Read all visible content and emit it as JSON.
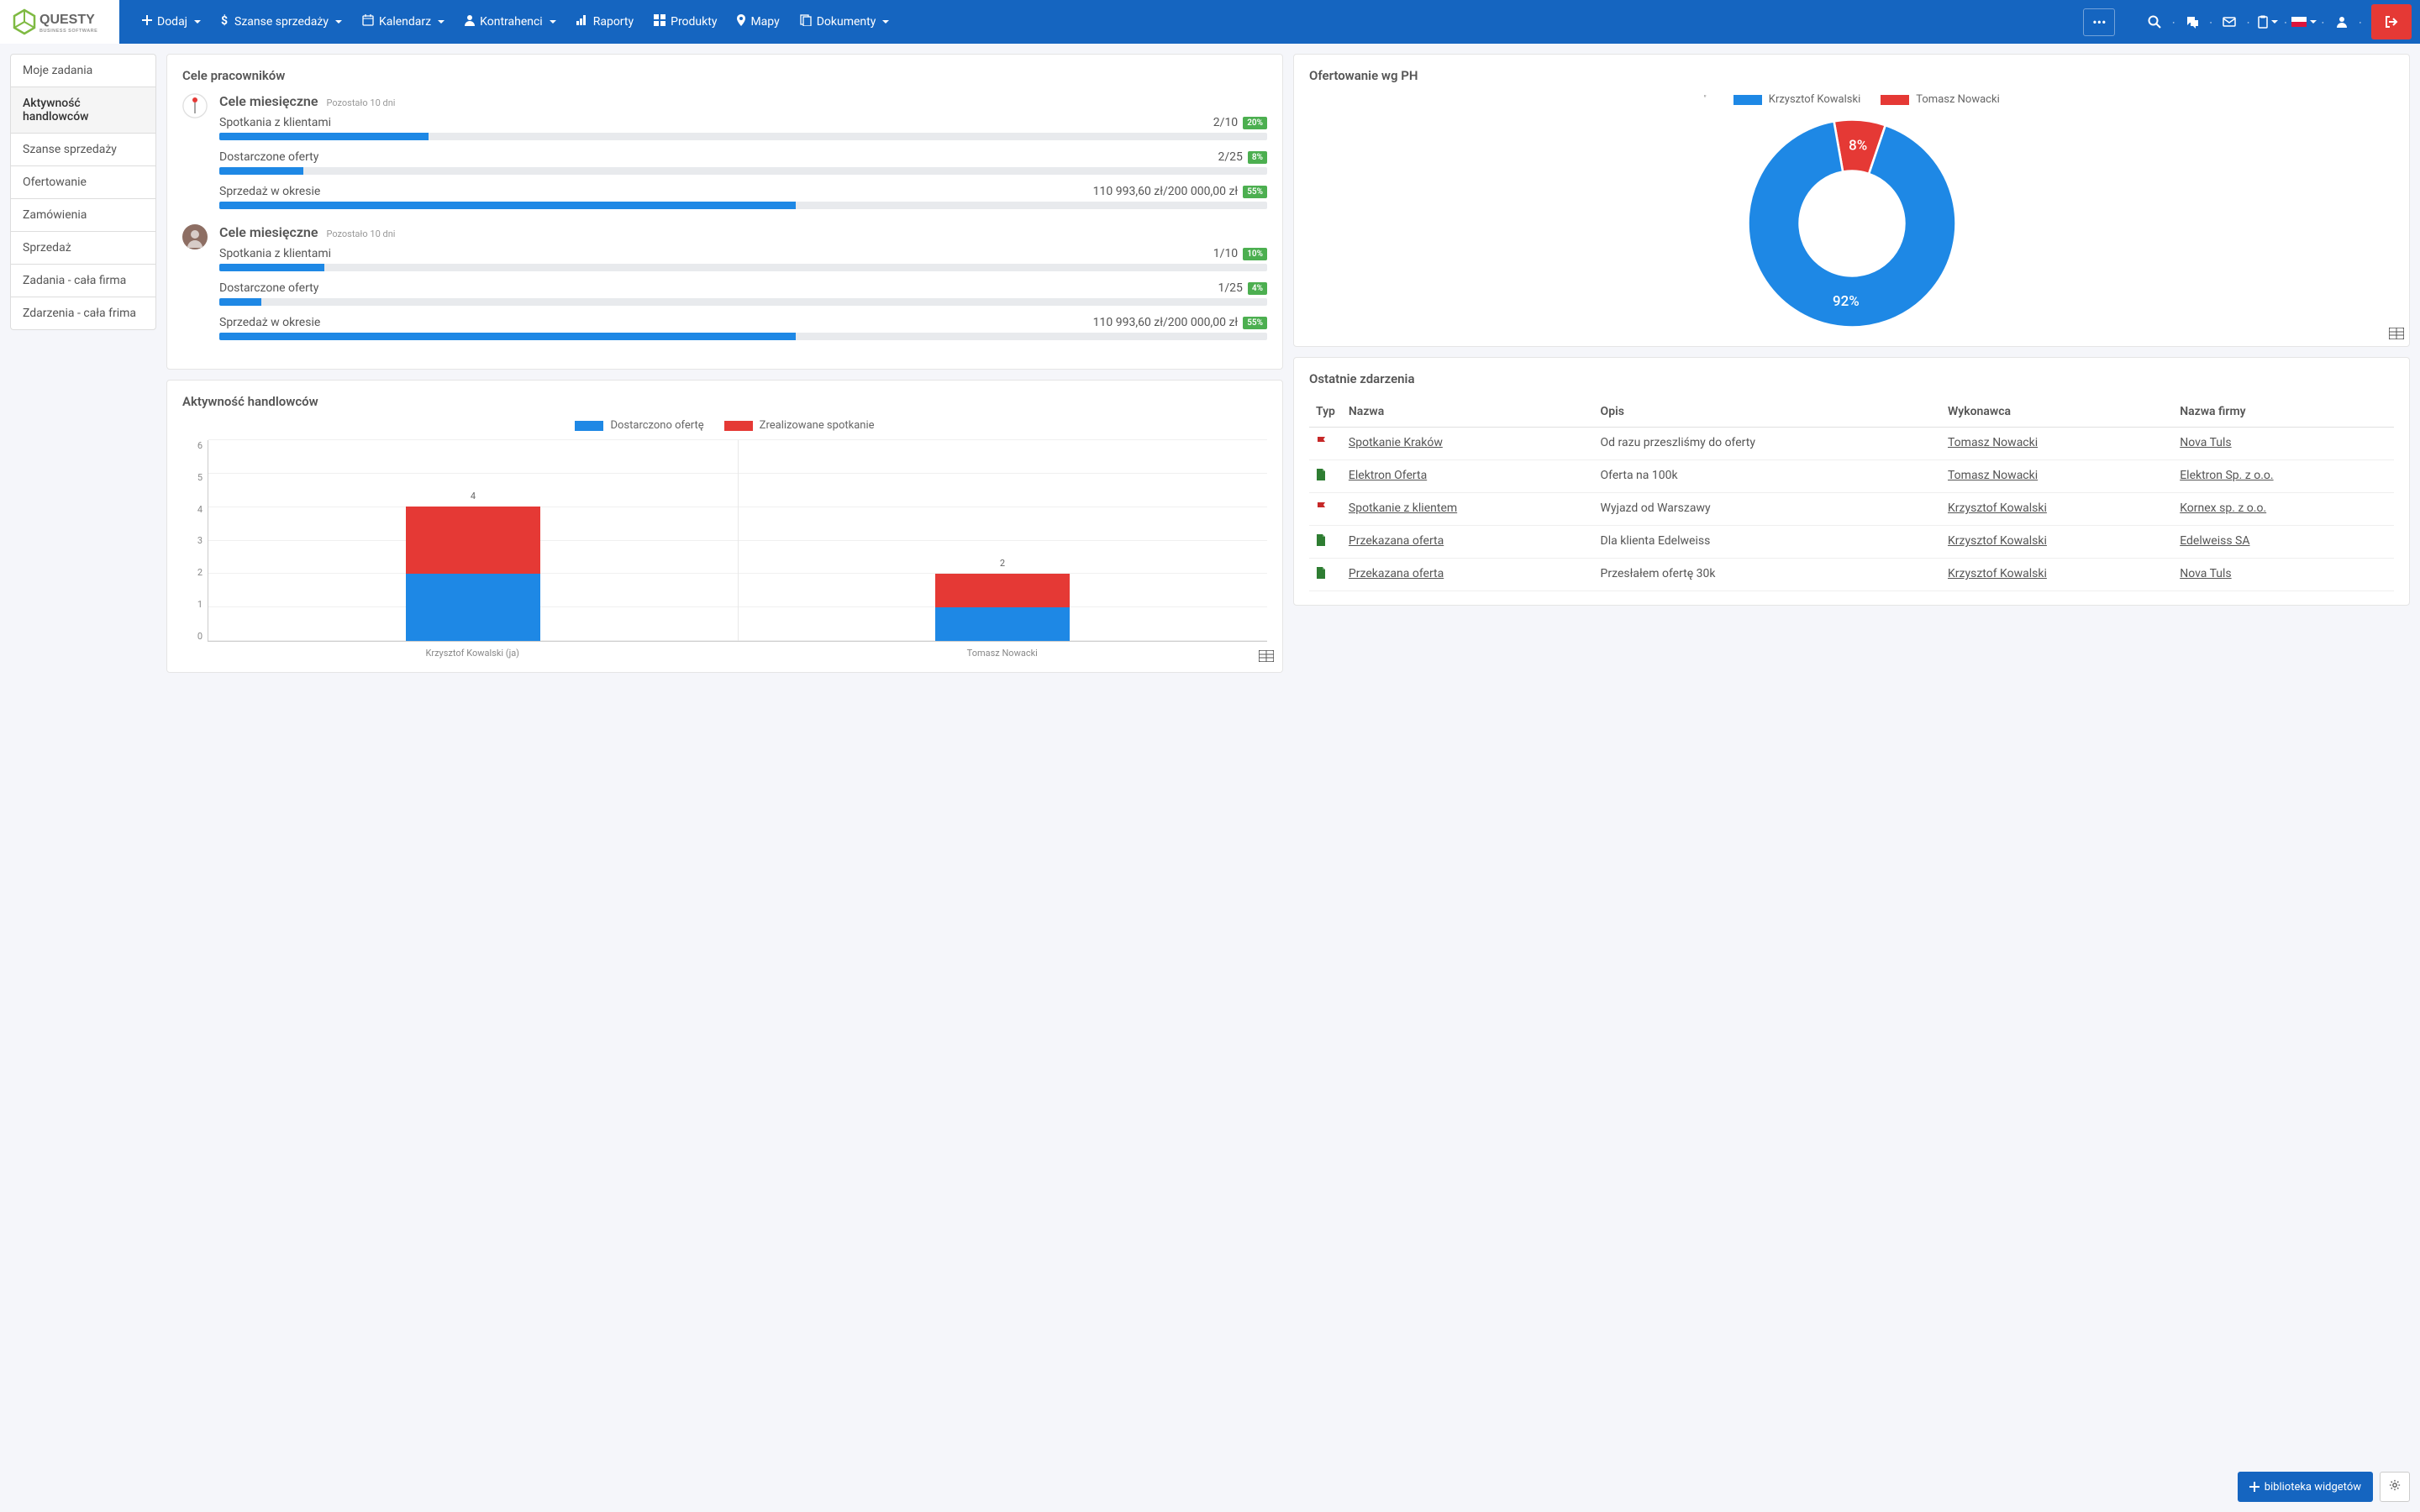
{
  "nav": {
    "brand": "QUESTY",
    "brand_sub": "BUSINESS SOFTWARE",
    "items": [
      {
        "label": "Dodaj",
        "icon": "plus"
      },
      {
        "label": "Szanse sprzedaży",
        "icon": "dollar"
      },
      {
        "label": "Kalendarz",
        "icon": "calendar"
      },
      {
        "label": "Kontrahenci",
        "icon": "user"
      },
      {
        "label": "Raporty",
        "icon": "chart"
      },
      {
        "label": "Produkty",
        "icon": "grid"
      },
      {
        "label": "Mapy",
        "icon": "pin"
      },
      {
        "label": "Dokumenty",
        "icon": "file"
      }
    ]
  },
  "sidebar": {
    "tabs": [
      "Moje zadania",
      "Aktywność handlowców",
      "Szanse sprzedaży",
      "Ofertowanie",
      "Zamówienia",
      "Sprzedaż",
      "Zadania - cała firma",
      "Zdarzenia - cała frima"
    ],
    "active": 1
  },
  "goals_card": {
    "title": "Cele pracowników",
    "users": [
      {
        "avatar_bg": "#fff",
        "title": "Cele miesięczne",
        "sub": "Pozostało 10 dni",
        "items": [
          {
            "name": "Spotkania z klientami",
            "val": "2/10",
            "pct": 20,
            "badge": "20%"
          },
          {
            "name": "Dostarczone oferty",
            "val": "2/25",
            "pct": 8,
            "badge": "8%"
          },
          {
            "name": "Sprzedaż w okresie",
            "val": "110 993,60 zł/200 000,00 zł",
            "pct": 55,
            "badge": "55%"
          }
        ]
      },
      {
        "avatar_bg": "#8d6e63",
        "title": "Cele miesięczne",
        "sub": "Pozostało 10 dni",
        "items": [
          {
            "name": "Spotkania z klientami",
            "val": "1/10",
            "pct": 10,
            "badge": "10%"
          },
          {
            "name": "Dostarczone oferty",
            "val": "1/25",
            "pct": 4,
            "badge": "4%"
          },
          {
            "name": "Sprzedaż w okresie",
            "val": "110 993,60 zł/200 000,00 zł",
            "pct": 55,
            "badge": "55%"
          }
        ]
      }
    ]
  },
  "activity_card": {
    "title": "Aktywność handlowców"
  },
  "donut_card": {
    "title": "Ofertowanie wg PH"
  },
  "events_card": {
    "title": "Ostatnie zdarzenia",
    "headers": [
      "Typ",
      "Nazwa",
      "Opis",
      "Wykonawca",
      "Nazwa firmy"
    ],
    "rows": [
      {
        "type": "flag",
        "name": "Spotkanie Kraków",
        "desc": "Od razu przeszliśmy do oferty",
        "who": "Tomasz Nowacki",
        "firm": "Nova Tuls"
      },
      {
        "type": "file",
        "name": "Elektron Oferta",
        "desc": "Oferta na 100k",
        "who": "Tomasz Nowacki",
        "firm": "Elektron Sp. z o.o."
      },
      {
        "type": "flag",
        "name": "Spotkanie z klientem",
        "desc": "Wyjazd od Warszawy",
        "who": "Krzysztof Kowalski",
        "firm": "Kornex sp. z o.o."
      },
      {
        "type": "file",
        "name": "Przekazana oferta",
        "desc": "Dla klienta Edelweiss",
        "who": "Krzysztof Kowalski",
        "firm": "Edelweiss SA"
      },
      {
        "type": "file",
        "name": "Przekazana oferta",
        "desc": "Przesłałem ofertę 30k",
        "who": "Krzysztof Kowalski",
        "firm": "Nova Tuls"
      }
    ]
  },
  "footer": {
    "widgets_btn": "biblioteka widgetów"
  },
  "chart_data": [
    {
      "type": "bar",
      "title": "Aktywność handlowców",
      "stacked": true,
      "categories": [
        "Krzysztof Kowalski (ja)",
        "Tomasz Nowacki"
      ],
      "series": [
        {
          "name": "Dostarczono ofertę",
          "color": "#1e88e5",
          "values": [
            2,
            1
          ]
        },
        {
          "name": "Zrealizowane spotkanie",
          "color": "#e53935",
          "values": [
            2,
            1
          ]
        }
      ],
      "totals": [
        4,
        2
      ],
      "ylim": [
        0,
        6
      ],
      "yticks": [
        0,
        1,
        2,
        3,
        4,
        5,
        6
      ]
    },
    {
      "type": "pie",
      "title": "Ofertowanie wg PH",
      "series": [
        {
          "name": "Krzysztof Kowalski",
          "color": "#1e88e5",
          "value": 92,
          "label": "92%"
        },
        {
          "name": "Tomasz Nowacki",
          "color": "#e53935",
          "value": 8,
          "label": "8%"
        }
      ]
    }
  ]
}
